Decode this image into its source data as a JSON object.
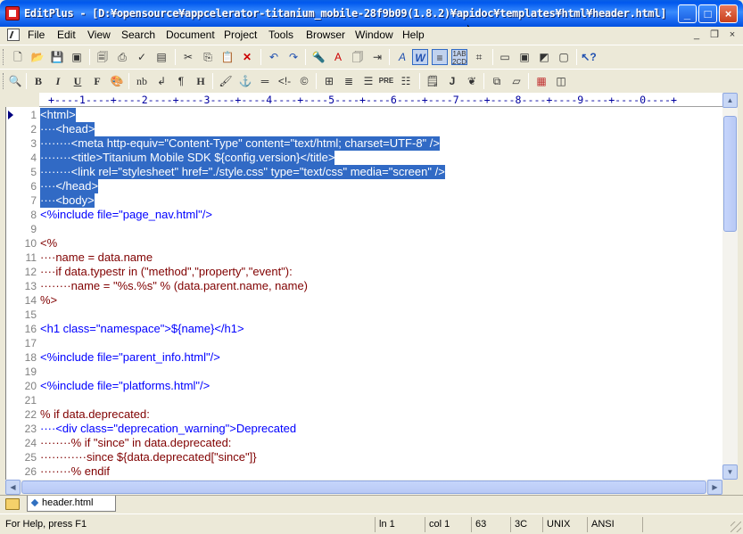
{
  "window": {
    "title": "EditPlus - [D:¥opensource¥appcelerator-titanium_mobile-28f9b09(1.8.2)¥apidoc¥templates¥html¥header.html]"
  },
  "menu": [
    "File",
    "Edit",
    "View",
    "Search",
    "Document",
    "Project",
    "Tools",
    "Browser",
    "Window",
    "Help"
  ],
  "toolbar2_labels": {
    "bold": "B",
    "italic": "I",
    "underline": "U",
    "font": "F",
    "nbsp": "nb",
    "pre": "PRE",
    "h": "H"
  },
  "ruler": "+----1----+----2----+----3----+----4----+----5----+----6----+----7----+----8----+----9----+----0----+",
  "editor": {
    "line_numbers": [
      "1",
      "2",
      "3",
      "4",
      "5",
      "6",
      "7",
      "8",
      "9",
      "10",
      "11",
      "12",
      "13",
      "14",
      "15",
      "16",
      "17",
      "18",
      "19",
      "20",
      "21",
      "22",
      "23",
      "24",
      "25",
      "26"
    ],
    "lines": [
      "<html>",
      "····<head>",
      "········<meta http-equiv=\"Content-Type\" content=\"text/html; charset=UTF-8\" />",
      "········<title>Titanium Mobile SDK ${config.version}</title>",
      "········<link rel=\"stylesheet\" href=\"./style.css\" type=\"text/css\" media=\"screen\" />",
      "····</head>",
      "····<body>",
      "<%include file=\"page_nav.html\"/>",
      "",
      "<%",
      "····name = data.name",
      "····if data.typestr in (\"method\",\"property\",\"event\"):",
      "········name = \"%s.%s\" % (data.parent.name, name)",
      "%>",
      "",
      "<h1 class=\"namespace\">${name}</h1>",
      "",
      "<%include file=\"parent_info.html\"/>",
      "",
      "<%include file=\"platforms.html\"/>",
      "",
      "% if data.deprecated:",
      "····<div class=\"deprecation_warning\">Deprecated",
      "········% if \"since\" in data.deprecated:",
      "············since ${data.deprecated[\"since\"]}",
      "········% endif"
    ]
  },
  "tabs": [
    {
      "label": "header.html"
    }
  ],
  "status": {
    "help": "For Help, press F1",
    "line": "ln 1",
    "col": "col 1",
    "code_dec": "63",
    "code_hex": "3C",
    "eol": "UNIX",
    "encoding": "ANSI"
  },
  "colors": {
    "selection": "#316ac5",
    "tag": "#0000ff",
    "string": "#c000c0",
    "text": "#800000"
  }
}
